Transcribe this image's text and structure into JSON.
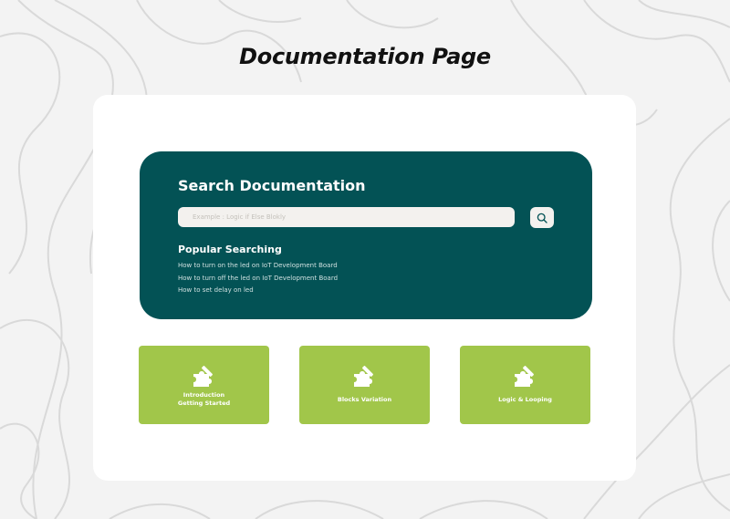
{
  "page": {
    "title": "Documentation Page"
  },
  "search": {
    "heading": "Search Documentation",
    "placeholder": "Example : Logic if Else Blokly",
    "value": ""
  },
  "popular": {
    "heading": "Popular Searching",
    "items": [
      "How to turn on the led on IoT Development Board",
      "How to turn off the led on IoT Development Board",
      "How to set delay on led"
    ]
  },
  "cards": [
    {
      "line1": "Introduction",
      "line2": "Getting Started",
      "icon": "puzzle-edit-icon"
    },
    {
      "line1": "Blocks Variation",
      "line2": "",
      "icon": "puzzle-edit-icon"
    },
    {
      "line1": "Logic & Looping",
      "line2": "",
      "icon": "puzzle-edit-icon"
    }
  ],
  "colors": {
    "background": "#f3f3f3",
    "panel": "#ffffff",
    "search_card": "#035255",
    "doc_card": "#a1c64a",
    "input": "#f3f1ee"
  }
}
